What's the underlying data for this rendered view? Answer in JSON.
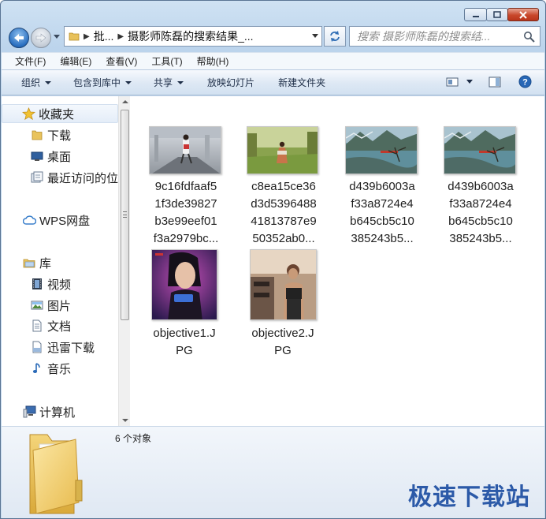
{
  "window": {
    "caption_buttons": [
      "minimize",
      "maximize",
      "close"
    ]
  },
  "address": {
    "crumb_1": "批...",
    "crumb_2": "摄影师陈磊的搜索结果_...",
    "search_placeholder": "搜索 摄影师陈磊的搜索结..."
  },
  "menu": [
    {
      "label": "文件(F)"
    },
    {
      "label": "编辑(E)"
    },
    {
      "label": "查看(V)"
    },
    {
      "label": "工具(T)"
    },
    {
      "label": "帮助(H)"
    }
  ],
  "toolbar": [
    {
      "label": "组织"
    },
    {
      "label": "包含到库中"
    },
    {
      "label": "共享"
    },
    {
      "label": "放映幻灯片"
    },
    {
      "label": "新建文件夹"
    }
  ],
  "sidebar": {
    "favorites": {
      "label": "收藏夹",
      "icon": "star-icon"
    },
    "favorite_items": [
      {
        "label": "下载",
        "icon": "folder-icon"
      },
      {
        "label": "桌面",
        "icon": "desktop-icon"
      },
      {
        "label": "最近访问的位",
        "icon": "recent-places-icon"
      }
    ],
    "wps": {
      "label": "WPS网盘",
      "icon": "cloud-icon"
    },
    "library": {
      "label": "库",
      "icon": "library-icon"
    },
    "library_items": [
      {
        "label": "视频",
        "icon": "video-icon"
      },
      {
        "label": "图片",
        "icon": "pictures-icon"
      },
      {
        "label": "文档",
        "icon": "documents-icon"
      },
      {
        "label": "迅雷下载",
        "icon": "thunder-download-icon"
      },
      {
        "label": "音乐",
        "icon": "music-icon"
      }
    ],
    "computer": {
      "label": "计算机",
      "icon": "computer-icon"
    }
  },
  "files": [
    {
      "name_lines": [
        "9c16fdfaaf5",
        "1f3de39827",
        "b3e99eef01",
        "f3a2979bc..."
      ]
    },
    {
      "name_lines": [
        "c8ea15ce36",
        "d3d5396488",
        "41813787e9",
        "50352ab0..."
      ]
    },
    {
      "name_lines": [
        "d439b6003a",
        "f33a8724e4",
        "b645cb5c10",
        "385243b5..."
      ]
    },
    {
      "name_lines": [
        "d439b6003a",
        "f33a8724e4",
        "b645cb5c10",
        "385243b5..."
      ]
    },
    {
      "name_lines": [
        "objective1.J",
        "PG"
      ]
    },
    {
      "name_lines": [
        "objective2.J",
        "PG"
      ]
    }
  ],
  "details": {
    "count": "6 个对象"
  },
  "watermark": "极速下载站"
}
